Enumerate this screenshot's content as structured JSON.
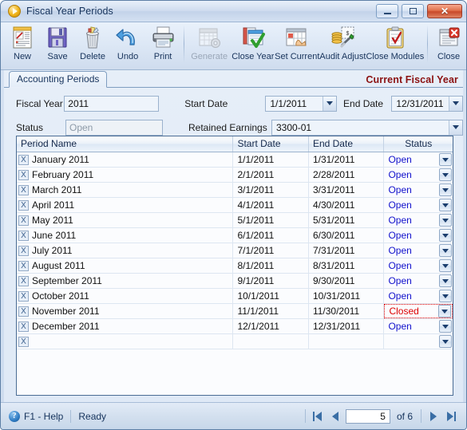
{
  "window": {
    "title": "Fiscal Year Periods",
    "minimize_label": "Minimize",
    "maximize_label": "Maximize",
    "close_label": "Close"
  },
  "toolbar": {
    "buttons": [
      {
        "label": "New",
        "icon": "new-document-icon",
        "disabled": false
      },
      {
        "label": "Save",
        "icon": "floppy-disk-icon",
        "disabled": false
      },
      {
        "label": "Delete",
        "icon": "trash-can-icon",
        "disabled": false
      },
      {
        "label": "Undo",
        "icon": "undo-arrow-icon",
        "disabled": false
      },
      {
        "label": "Print",
        "icon": "printer-icon",
        "disabled": false
      },
      {
        "label": "Generate",
        "icon": "calendar-gear-icon",
        "disabled": true
      },
      {
        "label": "Close Year",
        "icon": "document-check-icon",
        "disabled": false
      },
      {
        "label": "Set Current",
        "icon": "calendar-hand-icon",
        "disabled": false
      },
      {
        "label": "Audit Adjust",
        "icon": "coins-tools-icon",
        "disabled": false
      },
      {
        "label": "Close Modules",
        "icon": "clipboard-check-icon",
        "disabled": false
      },
      {
        "label": "Close",
        "icon": "window-close-icon",
        "disabled": false
      }
    ]
  },
  "tabs": {
    "items": [
      {
        "label": "Accounting Periods",
        "active": true
      }
    ],
    "banner": "Current Fiscal Year"
  },
  "form": {
    "fiscal_year_label": "Fiscal Year",
    "fiscal_year_value": "2011",
    "status_label": "Status",
    "status_value": "Open",
    "start_date_label": "Start Date",
    "start_date_value": "1/1/2011",
    "end_date_label": "End Date",
    "end_date_value": "12/31/2011",
    "retained_earnings_label": "Retained Earnings",
    "retained_earnings_value": "3300-01"
  },
  "grid": {
    "columns": [
      "Period Name",
      "Start Date",
      "End Date",
      "Status"
    ],
    "rows": [
      {
        "name": "January 2011",
        "start": "1/1/2011",
        "end": "1/31/2011",
        "status": "Open",
        "focused": false
      },
      {
        "name": "February 2011",
        "start": "2/1/2011",
        "end": "2/28/2011",
        "status": "Open",
        "focused": false
      },
      {
        "name": "March 2011",
        "start": "3/1/2011",
        "end": "3/31/2011",
        "status": "Open",
        "focused": false
      },
      {
        "name": "April 2011",
        "start": "4/1/2011",
        "end": "4/30/2011",
        "status": "Open",
        "focused": false
      },
      {
        "name": "May 2011",
        "start": "5/1/2011",
        "end": "5/31/2011",
        "status": "Open",
        "focused": false
      },
      {
        "name": "June 2011",
        "start": "6/1/2011",
        "end": "6/30/2011",
        "status": "Open",
        "focused": false
      },
      {
        "name": "July 2011",
        "start": "7/1/2011",
        "end": "7/31/2011",
        "status": "Open",
        "focused": false
      },
      {
        "name": "August 2011",
        "start": "8/1/2011",
        "end": "8/31/2011",
        "status": "Open",
        "focused": false
      },
      {
        "name": "September 2011",
        "start": "9/1/2011",
        "end": "9/30/2011",
        "status": "Open",
        "focused": false
      },
      {
        "name": "October 2011",
        "start": "10/1/2011",
        "end": "10/31/2011",
        "status": "Open",
        "focused": false
      },
      {
        "name": "November 2011",
        "start": "11/1/2011",
        "end": "11/30/2011",
        "status": "Closed",
        "focused": true
      },
      {
        "name": "December 2011",
        "start": "12/1/2011",
        "end": "12/31/2011",
        "status": "Open",
        "focused": false
      },
      {
        "name": "",
        "start": "",
        "end": "",
        "status": "",
        "focused": false
      }
    ],
    "delete_row_label": "X"
  },
  "statusbar": {
    "help_label": "F1 - Help",
    "state_label": "Ready",
    "help_icon_glyph": "?",
    "nav": {
      "first_label": "First",
      "prev_label": "Previous",
      "page_value": "5",
      "of_text": "of 6",
      "next_label": "Next",
      "last_label": "Last"
    }
  },
  "colors": {
    "accent": "#3a6ea5",
    "banner": "#8b1111",
    "status_open": "#1111cc",
    "status_closed": "#dd0000",
    "title_text": "#16335c"
  }
}
